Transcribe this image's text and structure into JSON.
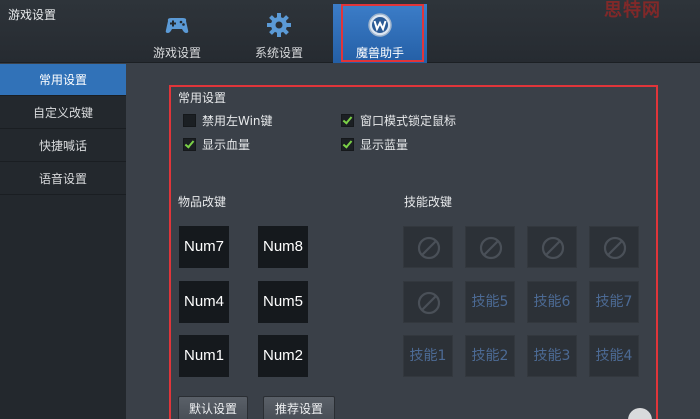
{
  "window": {
    "title": "游戏设置",
    "watermark": "思特网"
  },
  "tabs": [
    {
      "label": "游戏设置",
      "icon": "gamepad-icon"
    },
    {
      "label": "系统设置",
      "icon": "gear-icon"
    },
    {
      "label": "魔兽助手",
      "icon": "warcraft-logo-icon",
      "active": true
    }
  ],
  "sidebar": {
    "items": [
      {
        "label": "常用设置",
        "active": true
      },
      {
        "label": "自定义改键"
      },
      {
        "label": "快捷喊话"
      },
      {
        "label": "语音设置"
      }
    ]
  },
  "common": {
    "title": "常用设置",
    "options": [
      {
        "label": "禁用左Win键",
        "checked": false
      },
      {
        "label": "窗口模式锁定鼠标",
        "checked": true
      },
      {
        "label": "显示血量",
        "checked": true
      },
      {
        "label": "显示蓝量",
        "checked": true
      }
    ]
  },
  "item_keys": {
    "title": "物品改键",
    "keys": [
      "Num7",
      "Num8",
      "Num4",
      "Num5",
      "Num1",
      "Num2"
    ]
  },
  "skill_keys": {
    "title": "技能改键",
    "slots": [
      "",
      "",
      "",
      "",
      "",
      "技能5",
      "技能6",
      "技能7",
      "技能1",
      "技能2",
      "技能3",
      "技能4"
    ],
    "empty_icon": "disabled-icon"
  },
  "buttons": {
    "default": "默认设置",
    "recommended": "推荐设置"
  },
  "colors": {
    "accent": "#3172b8",
    "highlight": "#e0353a",
    "check": "#7bd147",
    "skill_text": "#4c6a94"
  }
}
